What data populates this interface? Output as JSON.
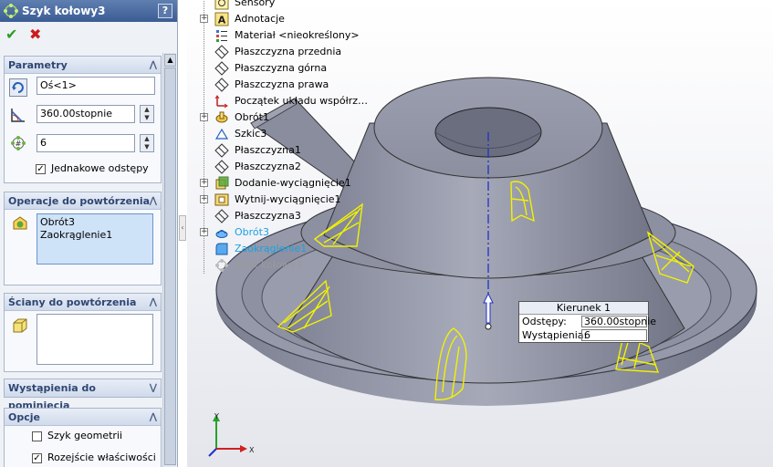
{
  "property_manager": {
    "title": "Szyk kołowy3",
    "help_glyph": "?",
    "ok_glyph": "✔",
    "cancel_glyph": "✖",
    "parameters": {
      "header": "Parametry",
      "axis_value": "Oś<1>",
      "angle_value": "360.00stopnie",
      "count_value": "6",
      "equal_spacing_label": "Jednakowe odstępy",
      "equal_spacing_checked": true
    },
    "features_to_pattern": {
      "header": "Operacje do powtórzenia",
      "items": [
        "Obrót3",
        "Zaokrąglenie1"
      ]
    },
    "faces_to_pattern": {
      "header": "Ściany do powtórzenia",
      "items": []
    },
    "instances_to_skip": {
      "header": "Wystąpienia do pominięcia"
    },
    "options": {
      "header": "Opcje",
      "geometry_pattern_label": "Szyk geometrii",
      "geometry_pattern_checked": false,
      "propagate_label": "Rozejście właściwości",
      "propagate_checked": true
    }
  },
  "feature_tree": {
    "items": [
      {
        "label": "Sensory",
        "icon": "sensor-icon",
        "expandable": false
      },
      {
        "label": "Adnotacje",
        "icon": "annotations-icon",
        "expandable": true
      },
      {
        "label": "Materiał <nieokreślony>",
        "icon": "material-icon",
        "expandable": false
      },
      {
        "label": "Płaszczyzna przednia",
        "icon": "plane-icon",
        "expandable": false
      },
      {
        "label": "Płaszczyzna górna",
        "icon": "plane-icon",
        "expandable": false
      },
      {
        "label": "Płaszczyzna prawa",
        "icon": "plane-icon",
        "expandable": false
      },
      {
        "label": "Początek układu współrz…",
        "icon": "origin-icon",
        "expandable": false
      },
      {
        "label": "Obrót1",
        "icon": "revolve-icon",
        "expandable": true
      },
      {
        "label": "Szkic3",
        "icon": "sketch-icon",
        "expandable": false
      },
      {
        "label": "Płaszczyzna1",
        "icon": "plane-icon",
        "expandable": false
      },
      {
        "label": "Płaszczyzna2",
        "icon": "plane-icon",
        "expandable": false
      },
      {
        "label": "Dodanie-wyciągnięcie1",
        "icon": "extrude-icon",
        "expandable": true
      },
      {
        "label": "Wytnij-wyciągnięcie1",
        "icon": "cut-extrude-icon",
        "expandable": true
      },
      {
        "label": "Płaszczyzna3",
        "icon": "plane-icon",
        "expandable": false
      },
      {
        "label": "Obrót3",
        "icon": "revolve-icon",
        "expandable": true,
        "state": "active"
      },
      {
        "label": "Zaokrąglenie1",
        "icon": "fillet-icon",
        "expandable": false,
        "state": "active"
      },
      {
        "label": "Szyk kołowy3",
        "icon": "circular-pattern-icon",
        "expandable": false,
        "state": "dim"
      }
    ]
  },
  "direction_callout": {
    "title": "Kierunek 1",
    "spacing_label": "Odstępy:",
    "spacing_value": "360.00stopnie",
    "instances_label": "Wystąpienia:",
    "instances_value": "6"
  },
  "triad": {
    "x_label": "X",
    "y_label": "Y"
  },
  "colors": {
    "title_bar": "#3b5c94",
    "model_body": "#8e92a3",
    "preview": "#f2f200",
    "axis": "#2030c8",
    "active_tree_item": "#1ea0e0"
  }
}
